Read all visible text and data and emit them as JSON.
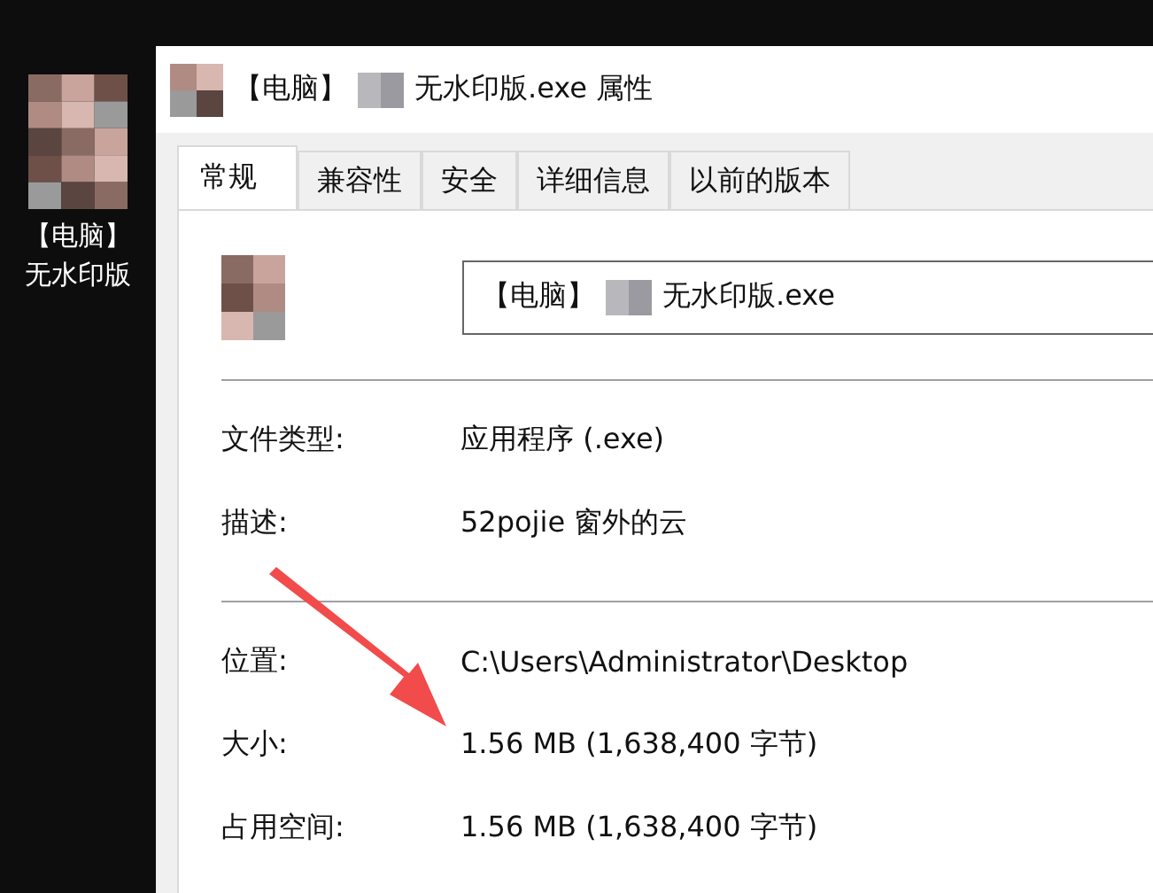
{
  "desktop_icon": {
    "label_lines": [
      "【电脑】",
      "无水印版"
    ]
  },
  "window": {
    "title_parts": [
      "【电脑】",
      "无水印版.exe 属性"
    ]
  },
  "tabs": [
    {
      "label": "常规",
      "selected": true
    },
    {
      "label": "兼容性",
      "selected": false
    },
    {
      "label": "安全",
      "selected": false
    },
    {
      "label": "详细信息",
      "selected": false
    },
    {
      "label": "以前的版本",
      "selected": false
    }
  ],
  "file_name": {
    "value_parts": [
      "【电脑】",
      "无水印版.exe"
    ]
  },
  "sections": [
    [
      {
        "label": "文件类型:",
        "value": "应用程序 (.exe)"
      },
      {
        "label": "描述:",
        "value": "52pojie 窗外的云"
      }
    ],
    [
      {
        "label": "位置:",
        "value": "C:\\Users\\Administrator\\Desktop"
      },
      {
        "label": "大小:",
        "value": "1.56 MB (1,638,400 字节)"
      },
      {
        "label": "占用空间:",
        "value": "1.56 MB (1,638,400 字节)"
      }
    ]
  ]
}
